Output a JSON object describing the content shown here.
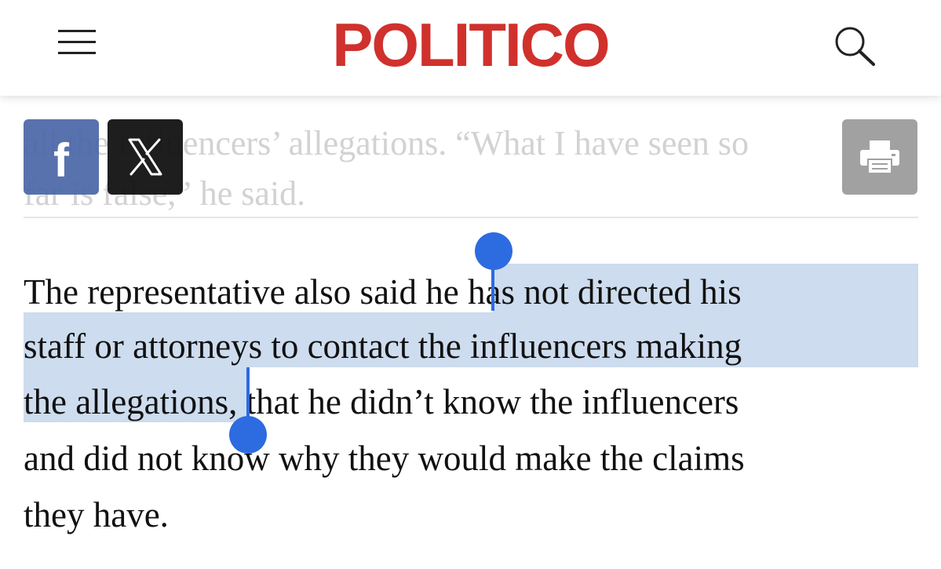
{
  "header": {
    "logo_text": "POLITICO",
    "menu_icon": "hamburger-menu-icon",
    "search_icon": "search-icon",
    "brand_color": "#d0312d"
  },
  "share": {
    "facebook_glyph": "f",
    "facebook_icon": "facebook-icon",
    "x_icon": "x-icon",
    "print_icon": "print-icon",
    "facebook_color": "#4a67a8",
    "x_color": "#111111",
    "print_color": "#9a9a9a"
  },
  "faded_paragraph": {
    "line1": "all the influencers’ allegations. “What I have seen so",
    "line2": "far is false,” he said."
  },
  "article": {
    "line1_before": "The representative also said ",
    "line1_selected": "he has not directed his",
    "line2_selected": "staff or attorneys to contact the influencers making",
    "line3_selected": "the allegations",
    "line3_after": ", that he didn’t know the influencers",
    "line4": "and did not know why they would make the claims",
    "line5": "they have."
  },
  "selection": {
    "highlight_color": "#c9daed",
    "handle_color": "#2d6be0"
  }
}
